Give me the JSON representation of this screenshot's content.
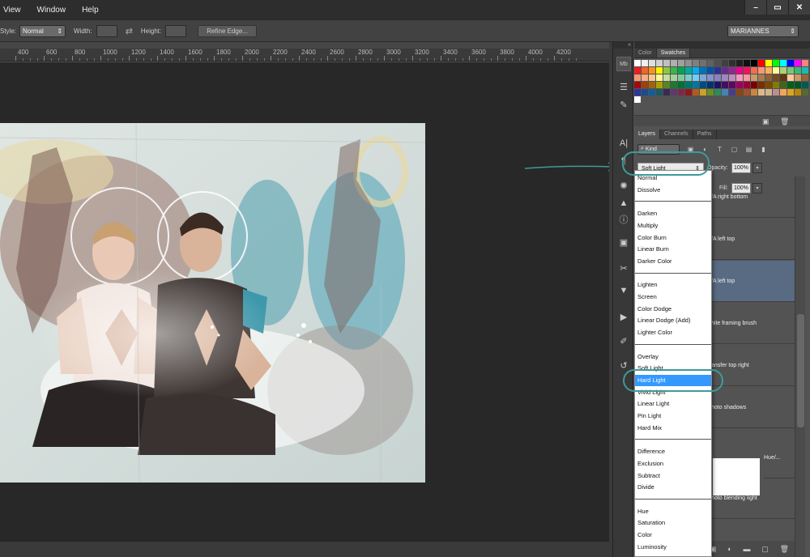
{
  "menu": [
    "View",
    "Window",
    "Help"
  ],
  "window_controls": [
    "–",
    "▭",
    "✕"
  ],
  "options": {
    "style_label": "Style:",
    "style_value": "Normal",
    "width_label": "Width:",
    "height_label": "Height:",
    "refine_label": "Refine Edge...",
    "workspace": "MARIANNES"
  },
  "ruler_ticks": [
    "400",
    "600",
    "800",
    "1000",
    "1200",
    "1400",
    "1600",
    "1800",
    "2000",
    "2200",
    "2400",
    "2600",
    "2800",
    "3000",
    "3200",
    "3400",
    "3600",
    "3800",
    "4000",
    "4200"
  ],
  "tools_badge": "Mb",
  "panel": {
    "tabs": [
      "Color",
      "Swatches"
    ],
    "active_tab": "Swatches",
    "layer_tabs": [
      "Layers",
      "Channels",
      "Paths"
    ],
    "kind_label": "Kind",
    "blend_value": "Soft Light",
    "opacity_label": "Opacity:",
    "opacity_value": "100%",
    "fill_label": "Fill:",
    "fill_value": "100%"
  },
  "layer_names": [
    "/A right bottom",
    "/A left top",
    "/A left top",
    "hite framing brush",
    "ansfer top right",
    "hoto shadows",
    "Hue/...",
    "hoto blending light"
  ],
  "blend_modes": [
    [
      "Normal",
      "Dissolve"
    ],
    [
      "Darken",
      "Multiply",
      "Color Burn",
      "Linear Burn",
      "Darker Color"
    ],
    [
      "Lighten",
      "Screen",
      "Color Dodge",
      "Linear Dodge (Add)",
      "Lighter Color"
    ],
    [
      "Overlay",
      "Soft Light",
      "Hard Light",
      "Vivid Light",
      "Linear Light",
      "Pin Light",
      "Hard Mix"
    ],
    [
      "Difference",
      "Exclusion",
      "Subtract",
      "Divide"
    ],
    [
      "Hue",
      "Saturation",
      "Color",
      "Luminosity"
    ]
  ],
  "highlighted_mode": "Hard Light",
  "colors": {
    "annotation": "#3f9a9a",
    "highlight": "#3399ff",
    "selected_layer": "#596b82"
  },
  "swatch_colors": [
    "#ffffff",
    "#f0f0f0",
    "#e0e0e0",
    "#d0d0d0",
    "#c0c0c0",
    "#b0b0b0",
    "#a0a0a0",
    "#909090",
    "#808080",
    "#707070",
    "#606060",
    "#505050",
    "#404040",
    "#303030",
    "#202020",
    "#101010",
    "#000000",
    "#ff0000",
    "#ffff00",
    "#00ff00",
    "#00ffff",
    "#0000ff",
    "#ff00ff",
    "#ff8080",
    "#ed1c24",
    "#f26522",
    "#f7941d",
    "#fff200",
    "#8dc63f",
    "#39b54a",
    "#00a651",
    "#00a99d",
    "#00aeef",
    "#0072bc",
    "#0054a6",
    "#2e3192",
    "#662d91",
    "#92278f",
    "#ec008c",
    "#ed145b",
    "#f26c4f",
    "#f69679",
    "#fbaf5d",
    "#fff799",
    "#acd373",
    "#7cc576",
    "#3bb878",
    "#1abbb4",
    "#f7977a",
    "#f9ad81",
    "#fdc68a",
    "#fff79a",
    "#c4df9b",
    "#a3d39c",
    "#82ca9d",
    "#7bcdc8",
    "#6ecff6",
    "#7ea7d8",
    "#8493ca",
    "#8882be",
    "#a187be",
    "#bc8dbf",
    "#f49ac2",
    "#f6989d",
    "#c69c6d",
    "#a67c52",
    "#8c6239",
    "#754c24",
    "#603913",
    "#ffcc99",
    "#cc9966",
    "#996633",
    "#9e0b0f",
    "#a0410d",
    "#a36209",
    "#aba000",
    "#598527",
    "#1a7b30",
    "#007236",
    "#00746b",
    "#0076a3",
    "#004b80",
    "#003471",
    "#1b1464",
    "#440e62",
    "#630460",
    "#9e005d",
    "#9e0039",
    "#790000",
    "#7b2e00",
    "#7d4900",
    "#827b00",
    "#406618",
    "#005e20",
    "#005826",
    "#005952",
    "#2f3699",
    "#1c4a8c",
    "#135e96",
    "#1f5b5a",
    "#3b2a51",
    "#5e3a6b",
    "#7a2b4b",
    "#8c1a1a",
    "#b35a1f",
    "#c9a227",
    "#6b8e23",
    "#2e8b57",
    "#4682b4",
    "#483d8b",
    "#8b4513",
    "#a0522d",
    "#cd853f",
    "#deb887",
    "#d2b48c",
    "#bc8f8f",
    "#f4a460",
    "#daa520",
    "#b8860b",
    "#556b2f",
    "#ffffff"
  ]
}
